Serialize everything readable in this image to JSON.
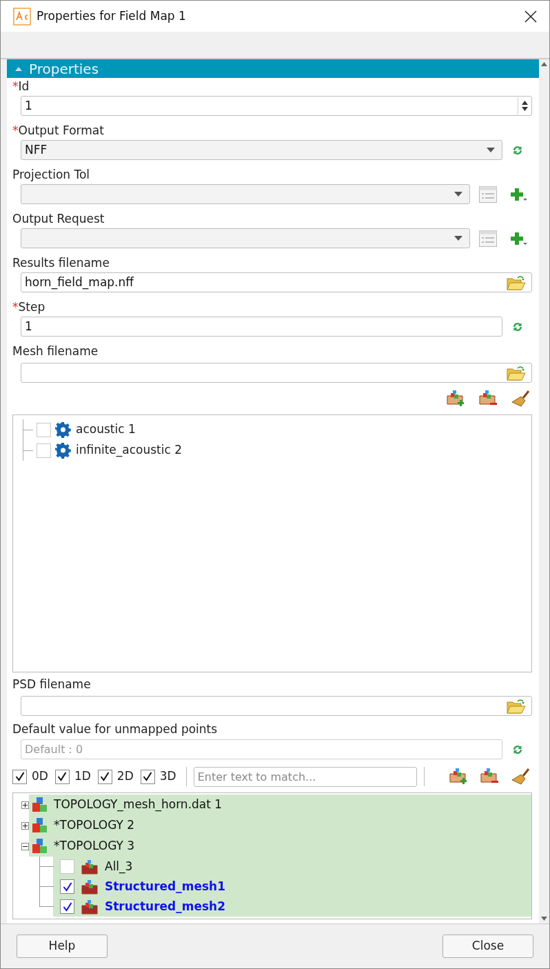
{
  "window": {
    "title": "Properties for Field Map 1"
  },
  "section": {
    "title": "Properties",
    "expanded": true
  },
  "fields": [
    {
      "kind": "spin",
      "required_mark": "*",
      "label": "Id",
      "value": "1"
    },
    {
      "kind": "select",
      "required_mark": "*",
      "label": "Output Format",
      "value": "NFF"
    },
    {
      "kind": "select-add",
      "label": "Projection Tol"
    },
    {
      "kind": "select-add",
      "label": "Output Request"
    },
    {
      "kind": "file",
      "label": "Results filename",
      "value": "horn_field_map.nff"
    },
    {
      "kind": "text",
      "required_mark": "*",
      "label": "Step",
      "value": "1"
    }
  ],
  "mesh_field": {
    "label": "Mesh filename"
  },
  "load_cases": [
    {
      "label": "acoustic 1",
      "checked": false
    },
    {
      "label": "infinite_acoustic 2",
      "checked": false
    }
  ],
  "psd_field": {
    "label": "PSD filename"
  },
  "default_field": {
    "label": "Default value for unmapped points",
    "placeholder": "Default : 0",
    "disabled": true
  },
  "filters": [
    {
      "label": "0D",
      "checked": true
    },
    {
      "label": "1D",
      "checked": true
    },
    {
      "label": "2D",
      "checked": true
    },
    {
      "label": "3D",
      "checked": true
    }
  ],
  "filter_search": {
    "placeholder": "Enter text to match..."
  },
  "topology": [
    {
      "label": "TOPOLOGY_mesh_horn.dat 1",
      "expanded": false
    },
    {
      "label": "*TOPOLOGY 2",
      "expanded": false
    },
    {
      "label": "*TOPOLOGY 3",
      "expanded": true,
      "children": [
        {
          "label": "All_3",
          "checked": false,
          "selected": false
        },
        {
          "label": "Structured_mesh1",
          "checked": true,
          "selected": true
        },
        {
          "label": "Structured_mesh2",
          "checked": true,
          "selected": true
        }
      ]
    }
  ],
  "buttons": [
    "Help",
    "Close"
  ]
}
